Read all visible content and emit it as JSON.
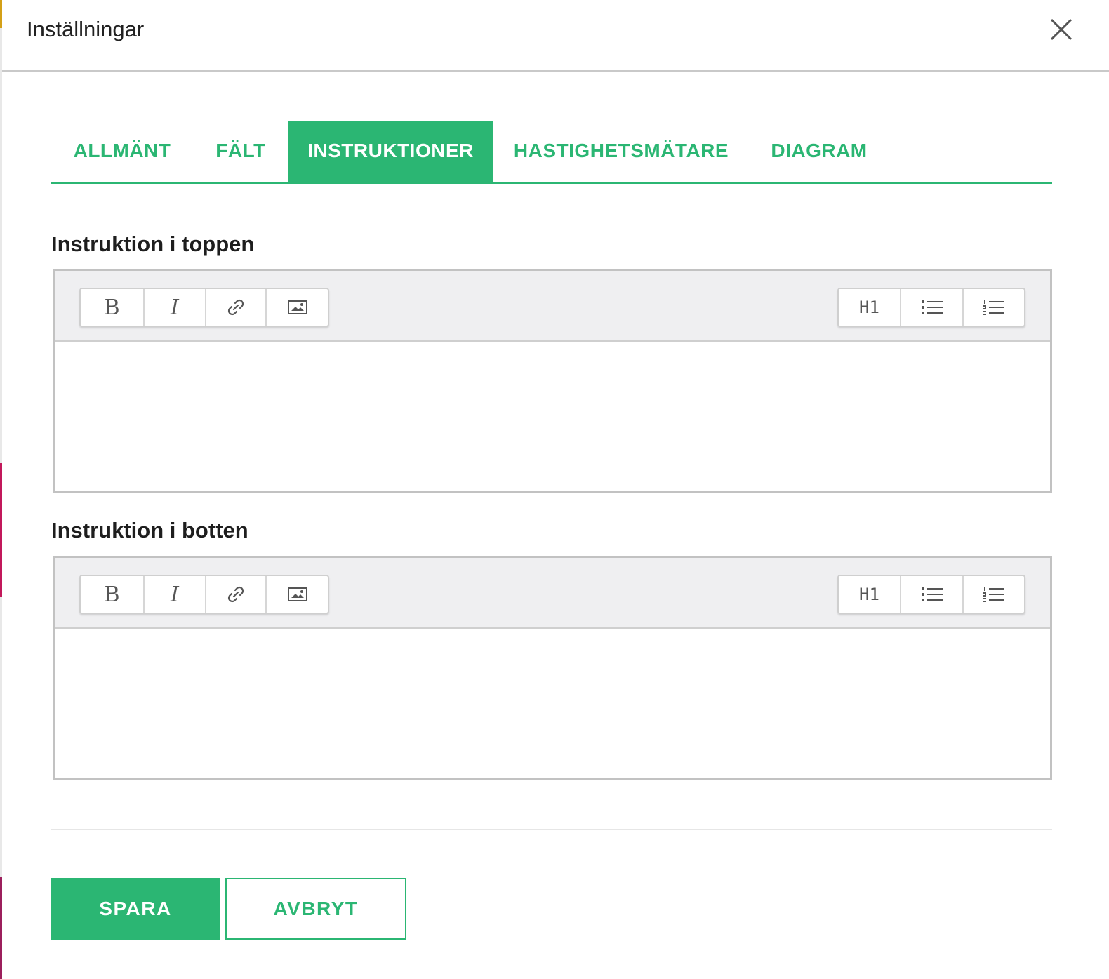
{
  "dialog": {
    "title": "Inställningar"
  },
  "tabs": [
    {
      "label": "ALLMÄNT",
      "active": false
    },
    {
      "label": "FÄLT",
      "active": false
    },
    {
      "label": "INSTRUKTIONER",
      "active": true
    },
    {
      "label": "HASTIGHETSMÄTARE",
      "active": false
    },
    {
      "label": "DIAGRAM",
      "active": false
    }
  ],
  "editors": {
    "top": {
      "label": "Instruktion i toppen",
      "content": ""
    },
    "bottom": {
      "label": "Instruktion i botten",
      "content": ""
    }
  },
  "toolbar": {
    "bold": "B",
    "italic": "I",
    "heading": "H1",
    "icons": [
      "bold-icon",
      "italic-icon",
      "link-icon",
      "image-icon",
      "heading-icon",
      "bulleted-list-icon",
      "numbered-list-icon"
    ]
  },
  "footer": {
    "save_label": "SPARA",
    "cancel_label": "AVBRYT"
  },
  "colors": {
    "accent": "#2bb673",
    "border": "#c2c2c2",
    "toolbar_bg": "#efeff1"
  }
}
